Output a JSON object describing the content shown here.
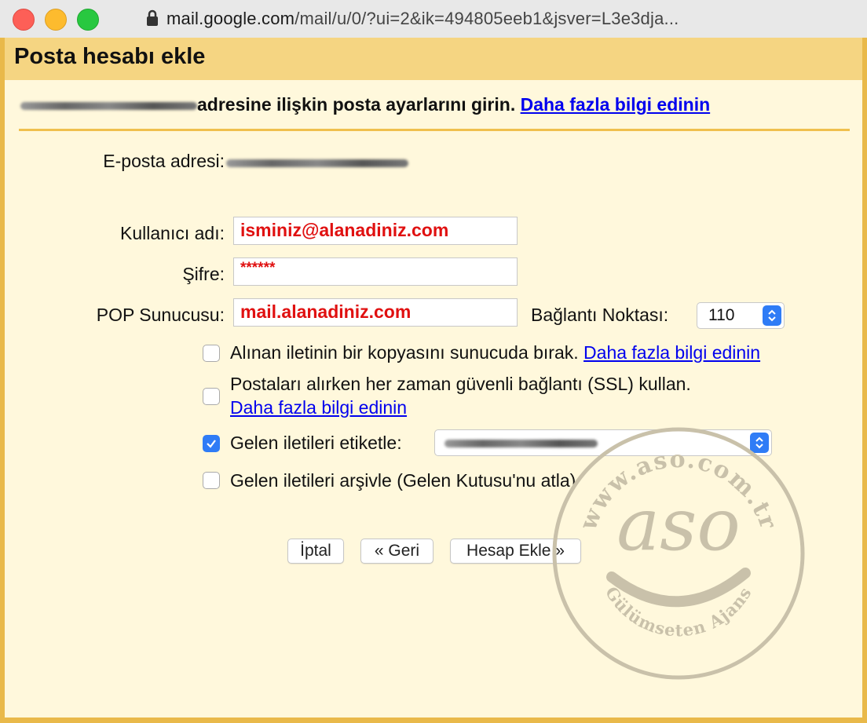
{
  "browser": {
    "url_host": "mail.google.com",
    "url_path": "/mail/u/0/?ui=2&ik=494805eeb1&jsver=L3e3dja..."
  },
  "dialog": {
    "title": "Posta hesabı ekle",
    "intro_text": "adresine ilişkin posta ayarlarını girin.",
    "intro_link": "Daha fazla bilgi edinin"
  },
  "form": {
    "email_label": "E-posta adresi:",
    "username_label": "Kullanıcı adı:",
    "username_value": "isminiz@alanadiniz.com",
    "password_label": "Şifre:",
    "password_value": "******",
    "pop_label": "POP Sunucusu:",
    "pop_value": "mail.alanadiniz.com",
    "port_label": "Bağlantı Noktası:",
    "port_value": "110"
  },
  "options": [
    {
      "text": "Alınan iletinin bir kopyasını sunucuda bırak.",
      "link": "Daha fazla bilgi edinin",
      "checked": false
    },
    {
      "text": "Postaları alırken her zaman güvenli bağlantı (SSL) kullan.",
      "link": "Daha fazla bilgi edinin",
      "checked": false
    },
    {
      "text": "Gelen iletileri etiketle:",
      "checked": true
    },
    {
      "text": "Gelen iletileri arşivle (Gelen Kutusu'nu atla)",
      "checked": false
    }
  ],
  "buttons": {
    "cancel": "İptal",
    "back": "« Geri",
    "add": "Hesap Ekle »"
  },
  "watermark": {
    "top_text": "www.aso.com.tr",
    "logo_text": "aso",
    "bottom_text": "Gülümseten Ajans"
  },
  "colors": {
    "header": "#f5d582",
    "content": "#fff8dc",
    "accent": "#2f7cf6",
    "input_text": "#e01010"
  }
}
